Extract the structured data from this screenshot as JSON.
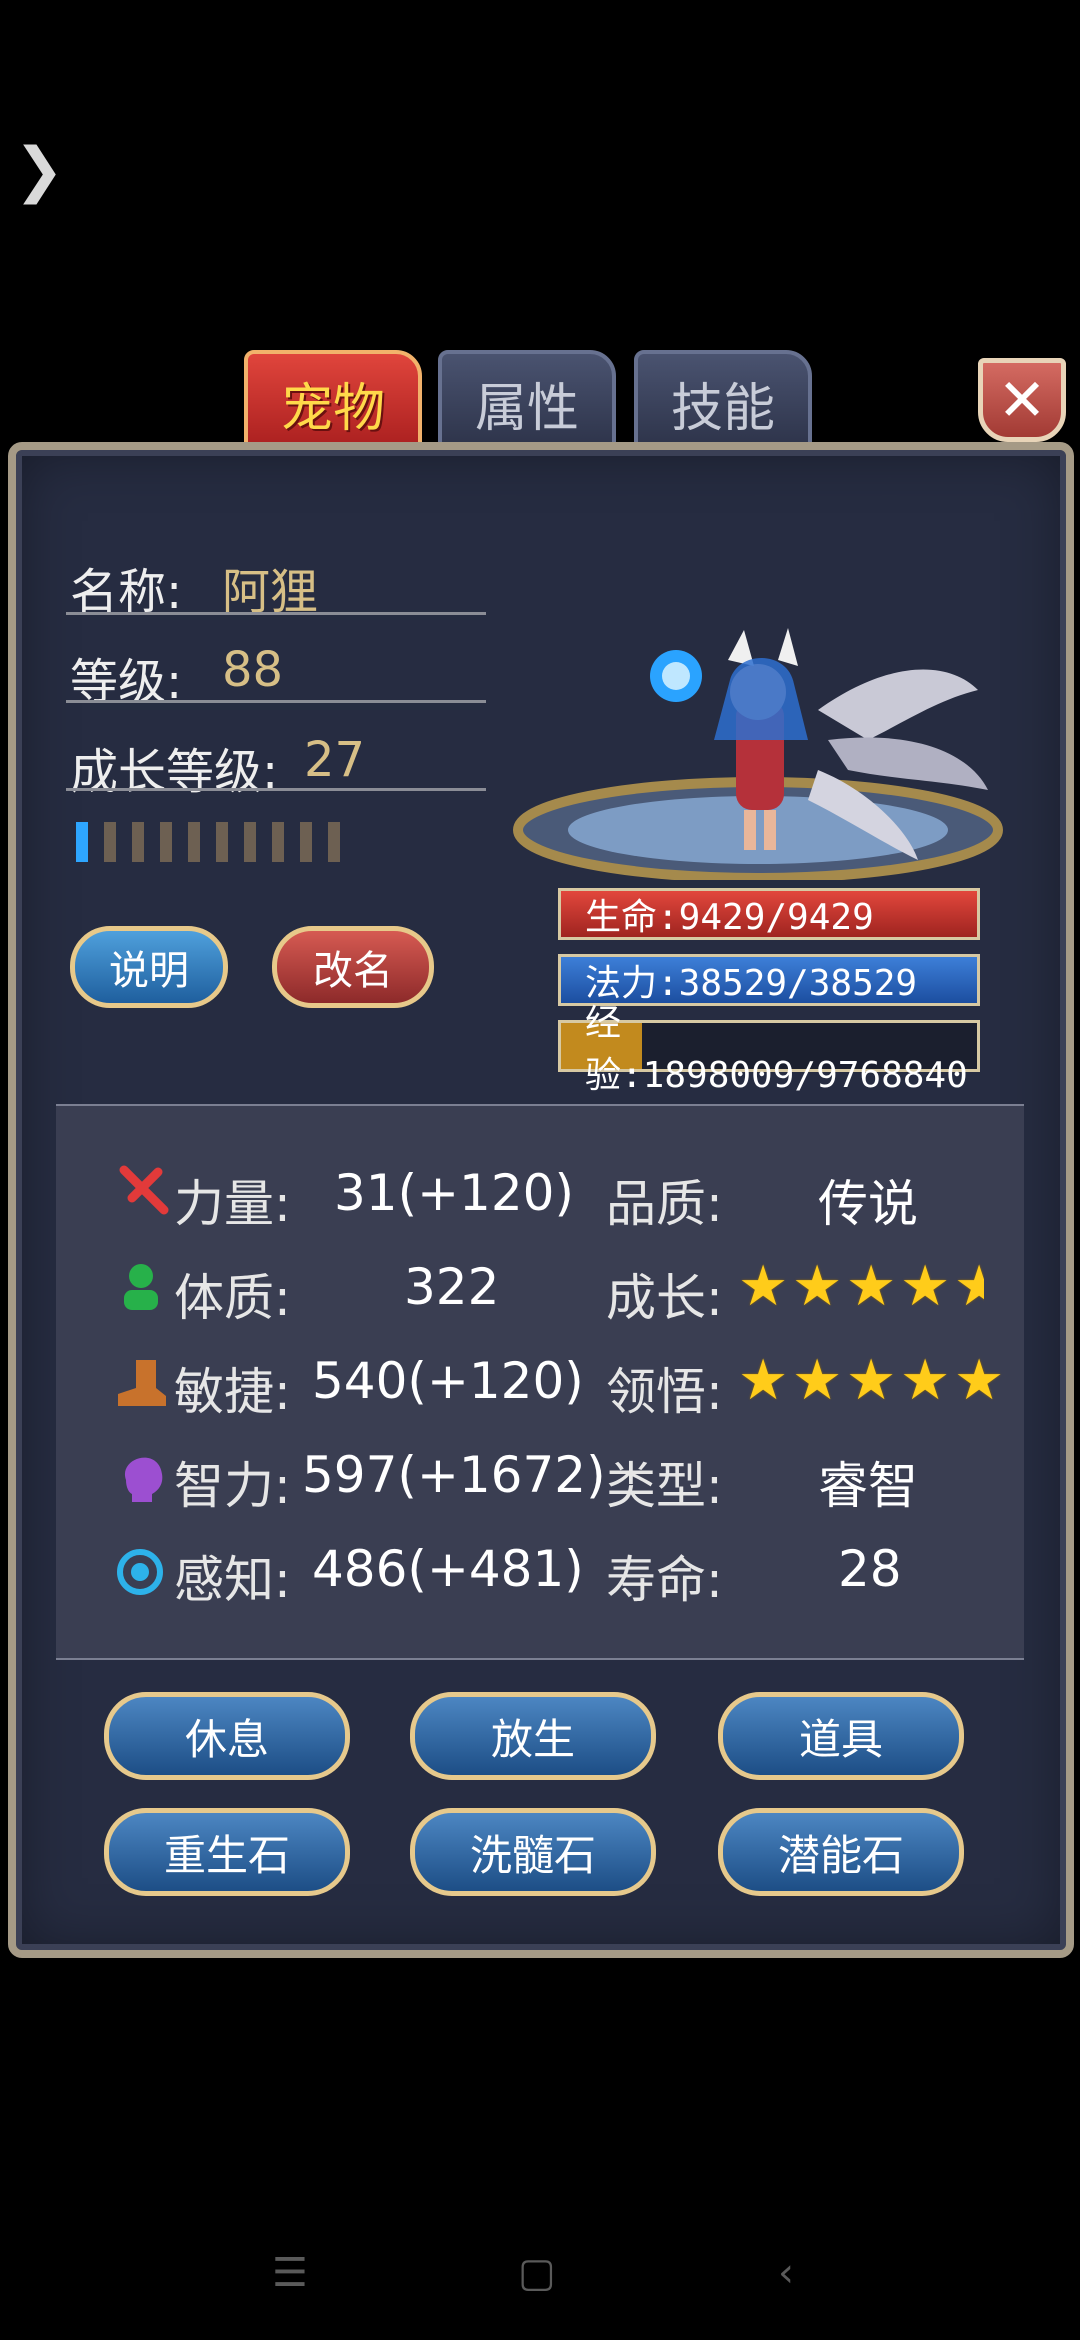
{
  "nav": {
    "back": "❯"
  },
  "tabs": {
    "pet": "宠物",
    "attributes": "属性",
    "skills": "技能"
  },
  "close": "✕",
  "info": {
    "name_label": "名称:",
    "name_value": "阿狸",
    "level_label": "等级:",
    "level_value": "88",
    "growth_label": "成长等级:",
    "growth_value": "27",
    "growth_progress_segments_filled": 1,
    "growth_progress_segments_total": 10
  },
  "buttons_top": {
    "explain": "说明",
    "rename": "改名"
  },
  "bars": {
    "hp": "生命:9429/9429",
    "mp": "法力:38529/38529",
    "exp": "经验:1898009/9768840",
    "exp_fraction": 0.194
  },
  "attributes": {
    "strength_label": "力量:",
    "strength_value": "31(+120)",
    "constitution_label": "体质:",
    "constitution_value": "322",
    "agility_label": "敏捷:",
    "agility_value": "540(+120)",
    "intellect_label": "智力:",
    "intellect_value": "597(+1672)",
    "perception_label": "感知:",
    "perception_value": "486(+481)",
    "quality_label": "品质:",
    "quality_value": "传说",
    "growth_label": "成长:",
    "growth_stars": 4.5,
    "insight_label": "领悟:",
    "insight_stars": 5,
    "type_label": "类型:",
    "type_value": "睿智",
    "lifespan_label": "寿命:",
    "lifespan_value": "28"
  },
  "actions": {
    "rest": "休息",
    "release": "放生",
    "items": "道具",
    "rebirth_stone": "重生石",
    "cleanse_stone": "洗髓石",
    "potential_stone": "潜能石"
  },
  "system_nav": {
    "menu": "☰",
    "home": "▢",
    "back": "‹"
  },
  "colors": {
    "panel": "#262c41",
    "accent_gold": "#d7bf86",
    "star": "#ffcc1a"
  }
}
